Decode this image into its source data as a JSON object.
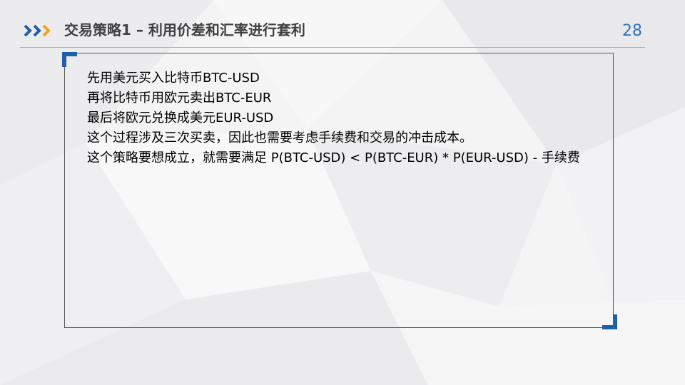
{
  "header": {
    "title": "交易策略1 – 利用价差和汇率进行套利",
    "page_number": "28"
  },
  "content": {
    "lines": [
      "先用美元买入比特币BTC-USD",
      "再将比特币用欧元卖出BTC-EUR",
      "最后将欧元兑换成美元EUR-USD",
      "这个过程涉及三次买卖，因此也需要考虑手续费和交易的冲击成本。",
      "这个策略要想成立，就需要满足 P(BTC-USD) < P(BTC-EUR) * P(EUR-USD) - 手续费"
    ]
  },
  "colors": {
    "accent_blue": "#1f5fa8",
    "chevron_orange": "#f4a11b",
    "page_number_blue": "#2e75b6"
  }
}
